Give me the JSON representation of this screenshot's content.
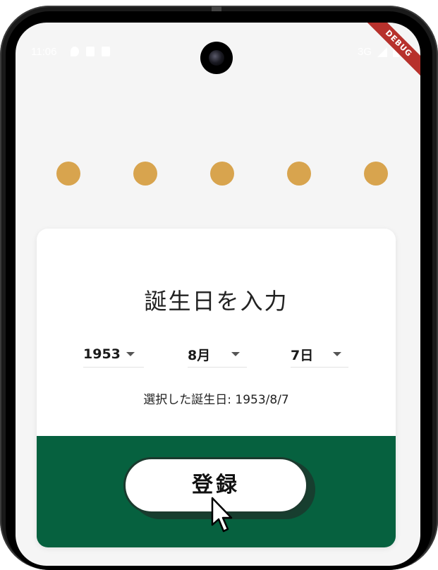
{
  "status_bar": {
    "time": "11:06",
    "network": "3G"
  },
  "debug_banner": "DEBUG",
  "progress_dots": {
    "count": 5,
    "color": "#d8a44e"
  },
  "card": {
    "title": "誕生日を入力",
    "year_dropdown": {
      "value": "1953"
    },
    "month_dropdown": {
      "value": "8月"
    },
    "day_dropdown": {
      "value": "7日"
    },
    "selected_birthday": "選択した誕生日: 1953/8/7",
    "register_button": "登録"
  },
  "colors": {
    "accent_green": "#06613f",
    "dot_gold": "#d8a44e",
    "background": "#f5f5f5"
  },
  "icons": [
    "location-icon",
    "sim-card-icon",
    "a-badge-icon",
    "signal-icon",
    "battery-icon",
    "camera-icon",
    "caret-down-icon",
    "mouse-pointer-icon"
  ]
}
